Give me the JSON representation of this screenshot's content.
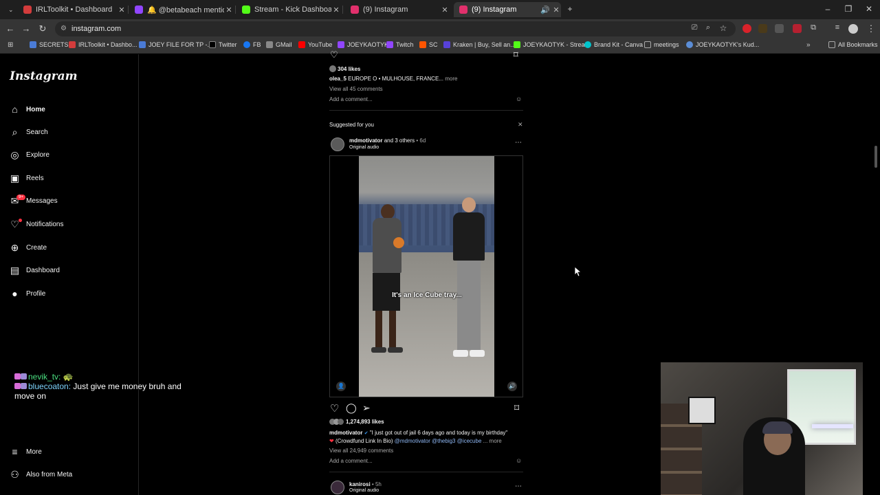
{
  "browser": {
    "tabs": [
      {
        "title": "IRLToolkit • Dashboard",
        "color": "#d33c3c"
      },
      {
        "title": "🔔 @betabeach mentioned yo...",
        "color": "#9146ff"
      },
      {
        "title": "Stream - Kick Dashboard",
        "color": "#53fc18"
      },
      {
        "title": "(9) Instagram",
        "color": "#e1306c"
      },
      {
        "title": "(9) Instagram",
        "color": "#e1306c"
      }
    ],
    "url": "instagram.com",
    "bookmarks": [
      {
        "label": "SECRETS",
        "color": "#4a7bd6"
      },
      {
        "label": "IRLToolkit • Dashbo...",
        "color": "#d33c3c"
      },
      {
        "label": "JOEY FILE FOR TP -...",
        "color": "#4a7bd6"
      },
      {
        "label": "Twitter",
        "color": "#000000"
      },
      {
        "label": "FB",
        "color": "#1877f2"
      },
      {
        "label": "GMail",
        "color": "#888888"
      },
      {
        "label": "YouTube",
        "color": "#ff0000"
      },
      {
        "label": "JOEYKAOTYK",
        "color": "#9146ff"
      },
      {
        "label": "Twitch",
        "color": "#9146ff"
      },
      {
        "label": "SC",
        "color": "#ff5500"
      },
      {
        "label": "Kraken | Buy, Sell an...",
        "color": "#5741d9"
      },
      {
        "label": "JOEYKAOTYK - Strea...",
        "color": "#53fc18"
      },
      {
        "label": "Brand Kit - Canva",
        "color": "#00c4cc"
      },
      {
        "label": "meetings",
        "color": "#aaaaaa"
      },
      {
        "label": "JOEYKAOTYK's Kud...",
        "color": "#5b8dd6"
      }
    ],
    "all_bookmarks": "All Bookmarks"
  },
  "sidebar": {
    "logo": "Instagram",
    "items": [
      {
        "label": "Home",
        "icon": "home-icon",
        "glyph": "⌂"
      },
      {
        "label": "Search",
        "icon": "search-icon",
        "glyph": "⌕"
      },
      {
        "label": "Explore",
        "icon": "explore-icon",
        "glyph": "◎"
      },
      {
        "label": "Reels",
        "icon": "reels-icon",
        "glyph": "▣"
      },
      {
        "label": "Messages",
        "icon": "messages-icon",
        "glyph": "✉"
      },
      {
        "label": "Notifications",
        "icon": "heart-icon",
        "glyph": "♡"
      },
      {
        "label": "Create",
        "icon": "create-icon",
        "glyph": "⊕"
      },
      {
        "label": "Dashboard",
        "icon": "dashboard-icon",
        "glyph": "▤"
      },
      {
        "label": "Profile",
        "icon": "profile-icon",
        "glyph": "●"
      }
    ],
    "messages_badge": "9+",
    "more": "More",
    "also_from_meta": "Also from Meta"
  },
  "prev_post": {
    "likes": "304 likes",
    "user": "olea_5",
    "caption": "EUROPE O • MULHOUSE, FRANCE...",
    "more": "more",
    "view_comments": "View all 45 comments",
    "add_comment": "Add a comment..."
  },
  "suggested": {
    "label": "Suggested for you"
  },
  "post": {
    "user": "mdmotivator",
    "and_others": "and 3 others",
    "age": "• 6d",
    "audio": "Original audio",
    "video_caption": "It's an Ice Cube tray...",
    "likes": "1,274,893 likes",
    "caption_user": "mdmotivator",
    "caption_text": "\"I just got out of jail 6 days ago and today is my birthday\"",
    "caption_line2": "(Crowdfund Link In Bio)",
    "mentions": "@mdmotivator @thebig3 @icecube",
    "more": "... more",
    "view_comments": "View all 24,949 comments",
    "add_comment": "Add a comment..."
  },
  "next_post": {
    "user": "kanirosi",
    "age": "• 5h",
    "audio": "Original audio"
  },
  "chat": [
    {
      "name": "nevik_tv:",
      "text": "🐢"
    },
    {
      "name": "bluecoaton:",
      "text": "Just give me money bruh and move on"
    }
  ]
}
